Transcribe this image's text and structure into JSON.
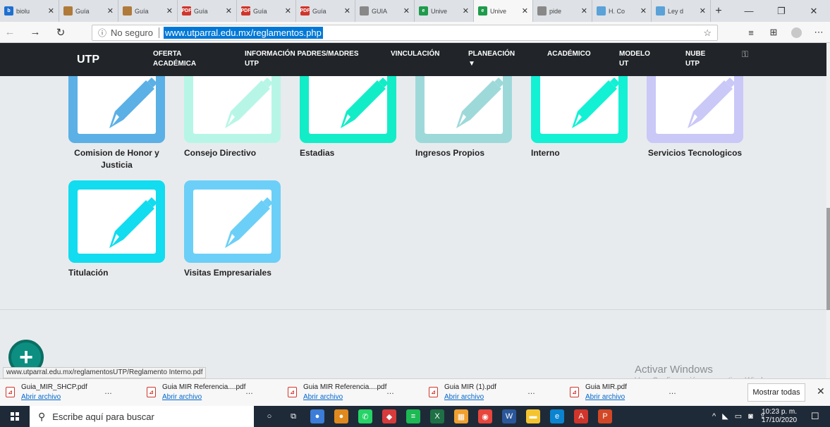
{
  "browser": {
    "tabs": [
      {
        "label": "biolu",
        "color": "#1e6fd0",
        "glyph": "b"
      },
      {
        "label": "Guía",
        "color": "#b07a3a",
        "glyph": ""
      },
      {
        "label": "Guía",
        "color": "#b07a3a",
        "glyph": ""
      },
      {
        "label": "Guía",
        "color": "#d0352b",
        "glyph": "PDF"
      },
      {
        "label": "Guía",
        "color": "#d0352b",
        "glyph": "PDF"
      },
      {
        "label": "Guía",
        "color": "#d0352b",
        "glyph": "PDF"
      },
      {
        "label": "GUIA",
        "color": "#888888",
        "glyph": ""
      },
      {
        "label": "Unive",
        "color": "#1e9b4b",
        "glyph": "e"
      },
      {
        "label": "Unive",
        "color": "#1e9b4b",
        "glyph": "e"
      },
      {
        "label": "pide",
        "color": "#888888",
        "glyph": ""
      },
      {
        "label": "H. Co",
        "color": "#5aa2d8",
        "glyph": ""
      },
      {
        "label": "Ley d",
        "color": "#5aa2d8",
        "glyph": ""
      }
    ],
    "active_tab_index": 8,
    "new_tab": "+",
    "window": {
      "minimize": "—",
      "restore": "❐",
      "close": "✕"
    },
    "nav": {
      "back": "←",
      "forward": "→",
      "refresh": "↻"
    },
    "security_text": "No seguro",
    "url": "www.utparral.edu.mx/reglamentos.php",
    "toolbar": {
      "favorites": "☆",
      "collections": "⩩",
      "share": "⊕",
      "more": "⋯"
    }
  },
  "site": {
    "brand": "UTP",
    "nav": [
      {
        "label": "OFERTA\nACADÉMICA"
      },
      {
        "label": "INFORMACIÓN PADRES/MADRES\nUTP"
      },
      {
        "label": "VINCULACIÓN"
      },
      {
        "label": "PLANEACIÓN\n▼"
      },
      {
        "label": "ACADÉMICO"
      },
      {
        "label": "MODELO\nUT"
      },
      {
        "label": "NUBE\nUTP"
      }
    ],
    "nav_icon": "⚿"
  },
  "regulations": [
    {
      "label": "Comision de Honor y Justicia",
      "color": "#5bb0e6",
      "align": "center"
    },
    {
      "label": "Consejo Directivo",
      "color": "#b7f6e6",
      "align": "left"
    },
    {
      "label": "Estadias",
      "color": "#12edc8",
      "align": "left"
    },
    {
      "label": "Ingresos Propios",
      "color": "#9ed9da",
      "align": "left"
    },
    {
      "label": "Interno",
      "color": "#12f1d4",
      "align": "left"
    },
    {
      "label": "Servicios Tecnologicos",
      "color": "#c9c8f7",
      "align": "center"
    },
    {
      "label": "Titulación",
      "color": "#12dcef",
      "align": "left"
    },
    {
      "label": "Visitas Empresariales",
      "color": "#6ccff7",
      "align": "left"
    }
  ],
  "fab": "+",
  "status_url": "www.utparral.edu.mx/reglamentosUTP/Reglamento Interno.pdf",
  "watermark": {
    "title": "Activar Windows",
    "subtitle": "Ve a Configuración para activar Windows."
  },
  "downloads": {
    "items": [
      {
        "name": "Guia_MIR_SHCP.pdf",
        "open": "Abrir archivo"
      },
      {
        "name": "Guia MIR Referencia....pdf",
        "open": "Abrir archivo"
      },
      {
        "name": "Guia MIR Referencia....pdf",
        "open": "Abrir archivo"
      },
      {
        "name": "Guia MIR (1).pdf",
        "open": "Abrir archivo"
      },
      {
        "name": "Guia MIR.pdf",
        "open": "Abrir archivo"
      }
    ],
    "more": "…",
    "show_all": "Mostrar todas",
    "close": "✕"
  },
  "taskbar": {
    "search_placeholder": "Escribe aquí para buscar",
    "apps": [
      {
        "name": "cortana",
        "color": "#1f2a38",
        "glyph": "○"
      },
      {
        "name": "task-view",
        "color": "#1f2a38",
        "glyph": "⧉"
      },
      {
        "name": "app-a",
        "color": "#3b7dd8",
        "glyph": "●"
      },
      {
        "name": "app-b",
        "color": "#e08a1e",
        "glyph": "●"
      },
      {
        "name": "whatsapp",
        "color": "#25d366",
        "glyph": "✆"
      },
      {
        "name": "app-c",
        "color": "#d83b3b",
        "glyph": "◆"
      },
      {
        "name": "spotify",
        "color": "#1db954",
        "glyph": "≡"
      },
      {
        "name": "excel",
        "color": "#1e7145",
        "glyph": "X"
      },
      {
        "name": "calculator",
        "color": "#f0a030",
        "glyph": "▦"
      },
      {
        "name": "chrome",
        "color": "#e8453c",
        "glyph": "◉"
      },
      {
        "name": "word",
        "color": "#2b579a",
        "glyph": "W"
      },
      {
        "name": "explorer",
        "color": "#f4c430",
        "glyph": "▬"
      },
      {
        "name": "edge",
        "color": "#0a84d0",
        "glyph": "e"
      },
      {
        "name": "acrobat",
        "color": "#d0352b",
        "glyph": "A"
      },
      {
        "name": "powerpoint",
        "color": "#d24726",
        "glyph": "P"
      }
    ],
    "tray": "^ ◣ ▭ ◙ ⇪",
    "time": "10:23 p. m.",
    "date": "17/10/2020",
    "notifications": "☐"
  }
}
